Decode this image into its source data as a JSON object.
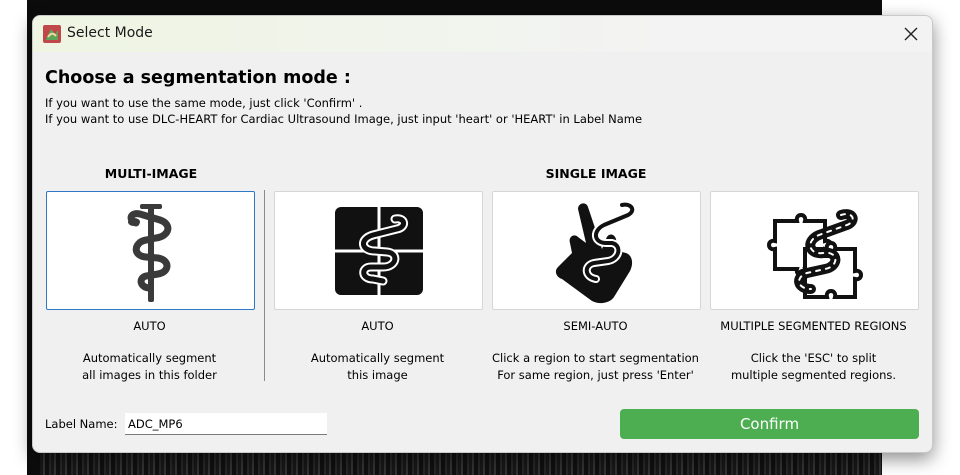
{
  "window": {
    "title": "Select Mode",
    "icon": "app-logo-icon",
    "close_icon": "close-icon"
  },
  "heading": "Choose a segmentation mode :",
  "instructions": [
    "If you want to use the same mode, just click 'Confirm' .",
    "If you want to use DLC-HEART for Cardiac Ultrasound Image, just input 'heart' or 'HEART' in Label Name"
  ],
  "sections": {
    "multi": "MULTI-IMAGE",
    "single": "SINGLE IMAGE"
  },
  "modes": [
    {
      "icon": "staff-of-asclepius-icon",
      "title": "AUTO",
      "desc1": "Automatically segment",
      "desc2": "all images in this folder",
      "selected": true
    },
    {
      "icon": "snake-on-square-icon",
      "title": "AUTO",
      "desc1": "Automatically segment",
      "desc2": "this image",
      "selected": false
    },
    {
      "icon": "snake-in-hand-icon",
      "title": "SEMI-AUTO",
      "desc1": "Click a region to start segmentation",
      "desc2": "For same region, just press 'Enter'",
      "selected": false
    },
    {
      "icon": "snake-on-puzzle-icon",
      "title": "MULTIPLE SEGMENTED REGIONS",
      "desc1": "Click the 'ESC' to split",
      "desc2": "multiple segmented regions.",
      "selected": false
    }
  ],
  "label": {
    "caption": "Label Name:",
    "value": "ADC_MP6"
  },
  "confirm_label": "Confirm",
  "colors": {
    "accent": "#4cae50",
    "selected_border": "#2e78c8",
    "dialog_bg": "#f0f0f0"
  }
}
